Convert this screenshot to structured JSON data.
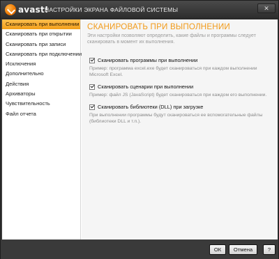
{
  "window": {
    "logo_text": "avast!",
    "title": "НАСТРОЙКИ ЭКРАНА ФАЙЛОВОЙ СИСТЕМЫ",
    "close_label": "✕"
  },
  "sidebar": {
    "items": [
      {
        "label": "Сканировать при выполнении",
        "active": true
      },
      {
        "label": "Сканировать при открытии",
        "active": false
      },
      {
        "label": "Сканировать при записи",
        "active": false
      },
      {
        "label": "Сканировать при подключении",
        "active": false
      },
      {
        "label": "Исключения",
        "active": false
      },
      {
        "label": "Дополнительно",
        "active": false
      },
      {
        "label": "Действия",
        "active": false
      },
      {
        "label": "Архиваторы",
        "active": false
      },
      {
        "label": "Чувствительность",
        "active": false
      },
      {
        "label": "Файл отчета",
        "active": false
      }
    ]
  },
  "main": {
    "title": "СКАНИРОВАТЬ ПРИ ВЫПОЛНЕНИИ",
    "description": "Эти настройки позволяют определить, какие файлы и программы следует сканировать в момент их выполнения.",
    "options": [
      {
        "label": "Сканировать программы при выполнении",
        "checked": true,
        "hint": "Пример: программа excel.exe будет сканироваться при каждом выполнении Microsoft Excel."
      },
      {
        "label": "Сканировать сценарии при выполнении",
        "checked": true,
        "hint": "Пример: файл JS (JavaScript) будет сканироваться при каждом его выполнении."
      },
      {
        "label": "Сканировать библиотеки (DLL) при загрузке",
        "checked": true,
        "hint": "При выполнении программы будут сканироваться ее вспомогательные файлы (библиотеки DLL и т.п.)."
      }
    ]
  },
  "footer": {
    "ok_label": "ОК",
    "cancel_label": "Отмена",
    "help_label": "?"
  }
}
